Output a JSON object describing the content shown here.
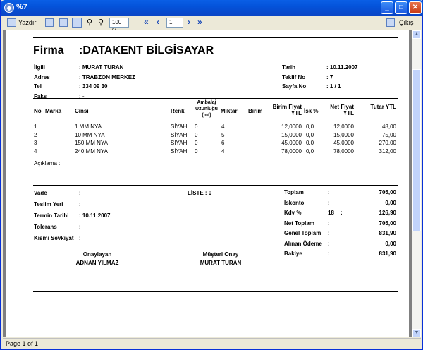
{
  "window": {
    "title": "%7"
  },
  "toolbar": {
    "print_label": "Yazdır",
    "zoom": "100 %",
    "page_input": "1",
    "exit_label": "Çıkış"
  },
  "status": {
    "page_text": "Page 1 of 1"
  },
  "doc": {
    "firma_label": "Firma",
    "firma_value": ":DATAKENT BİLGİSAYAR",
    "info_left": [
      {
        "label": "İlgili",
        "value": ": MURAT TURAN"
      },
      {
        "label": "Adres",
        "value": ": TRABZON MERKEZ"
      },
      {
        "label": "Tel",
        "value": ": 334 09 30"
      },
      {
        "label": "Faks",
        "value": ": -"
      }
    ],
    "info_right": [
      {
        "label": "Tarih",
        "value": ": 10.11.2007"
      },
      {
        "label": "Teklif No",
        "value": ": 7"
      },
      {
        "label": "Sayfa No",
        "value": ": 1     / 1"
      }
    ],
    "headers": {
      "no": "No",
      "marka": "Marka",
      "cinsi": "Cinsi",
      "renk": "Renk",
      "ambalaj": "Ambalaj Uzunluğu (mt)",
      "miktar": "Miktar",
      "birim": "Birim",
      "birim_fiyat": "Birim Fiyat YTL",
      "isk": "İsk %",
      "net_fiyat": "Net Fiyat YTL",
      "tutar": "Tutar YTL"
    },
    "rows": [
      {
        "no": "1",
        "cinsi": "1 MM NYA",
        "renk": "SİYAH",
        "ambalaj": "0",
        "miktar": "4",
        "birim_fiyat": "12,0000",
        "isk": "0,0",
        "net_fiyat": "12,0000",
        "tutar": "48,00"
      },
      {
        "no": "2",
        "cinsi": "10 MM NYA",
        "renk": "SİYAH",
        "ambalaj": "0",
        "miktar": "5",
        "birim_fiyat": "15,0000",
        "isk": "0,0",
        "net_fiyat": "15,0000",
        "tutar": "75,00"
      },
      {
        "no": "3",
        "cinsi": "150 MM NYA",
        "renk": "SİYAH",
        "ambalaj": "0",
        "miktar": "6",
        "birim_fiyat": "45,0000",
        "isk": "0,0",
        "net_fiyat": "45,0000",
        "tutar": "270,00"
      },
      {
        "no": "4",
        "cinsi": "240 MM NYA",
        "renk": "SİYAH",
        "ambalaj": "0",
        "miktar": "4",
        "birim_fiyat": "78,0000",
        "isk": "0,0",
        "net_fiyat": "78,0000",
        "tutar": "312,00"
      }
    ],
    "aciklama": "Açıklama :",
    "footer_left": [
      {
        "label": "Vade",
        "value": ":"
      },
      {
        "label": "Teslim Yeri",
        "value": ":"
      },
      {
        "label": "Termin Tarihi",
        "value": ": 10.11.2007"
      },
      {
        "label": "Tolerans",
        "value": ":"
      },
      {
        "label": "Kısmi Sevkiyat",
        "value": ":"
      }
    ],
    "liste": "LİSTE :  0",
    "sign": {
      "onaylayan_label": "Onaylayan",
      "onaylayan_name": "ADNAN YILMAZ",
      "musteri_label": "Müşteri Onay",
      "musteri_name": "MURAT TURAN"
    },
    "totals": [
      {
        "label": "Toplam",
        "colon": ":",
        "extra": "",
        "value": "705,00"
      },
      {
        "label": "İskonto",
        "colon": ":",
        "extra": "",
        "value": "0,00"
      },
      {
        "label": "Kdv %",
        "colon": "18",
        "extra": ":",
        "value": "126,90"
      },
      {
        "label": "Net Toplam",
        "colon": ":",
        "extra": "",
        "value": "705,00"
      },
      {
        "label": "Genel Toplam",
        "colon": ":",
        "extra": "",
        "value": "831,90"
      },
      {
        "label": "Alınan Ödeme",
        "colon": ":",
        "extra": "",
        "value": "0,00"
      },
      {
        "label": "Bakiye",
        "colon": ":",
        "extra": "",
        "value": "831,90"
      }
    ]
  }
}
